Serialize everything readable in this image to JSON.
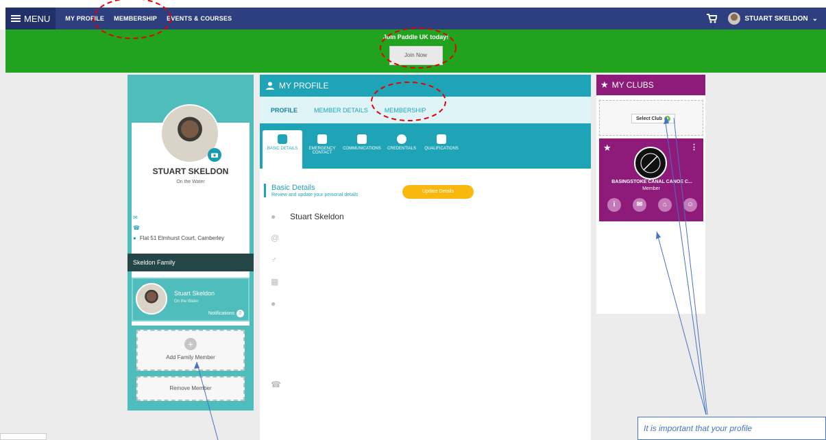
{
  "nav": {
    "menu_label": "MENU",
    "links": [
      "MY PROFILE",
      "MEMBERSHIP",
      "EVENTS & COURSES"
    ],
    "user_name": "STUART SKELDON",
    "user_caret": "⌄"
  },
  "banner": {
    "title": "Join Paddle UK today!",
    "button": "Join Now"
  },
  "profile": {
    "name": "STUART SKELDON",
    "status": "On the Water",
    "address": "Flat 51 Elmhurst Court, Camberley",
    "family_title": "Skeldon Family",
    "family_member": {
      "name": "Stuart Skeldon",
      "status": "On the Water",
      "notifications_label": "Notifications",
      "notifications_count": "0"
    },
    "add_member": "Add Family Member",
    "remove_member": "Remove Member"
  },
  "center": {
    "title": "MY PROFILE",
    "tabs": [
      "PROFILE",
      "MEMBER DETAILS",
      "MEMBERSHIP"
    ],
    "subtabs": [
      "BASIC DETAILS",
      "EMERGENCY CONTACT",
      "COMMUNICATIONS",
      "CREDENTIALS",
      "QUALIFICATIONS"
    ],
    "section_title": "Basic Details",
    "section_subtitle": "Review and update your personal details",
    "update_button": "Update Details",
    "full_name": "Stuart Skeldon"
  },
  "clubs": {
    "title": "MY CLUBS",
    "select_button": "Select Club",
    "club_name": "BASINGSTOKE CANAL CANOE C...",
    "club_role": "Member"
  },
  "annotation": {
    "note": "It is important that your profile"
  },
  "colors": {
    "nav": "#2e3f7f",
    "banner": "#22a320",
    "teal": "#4fbdbb",
    "accent": "#1fa4b7",
    "club": "#8e1a79",
    "button_yellow": "#f8b80e",
    "annotation": "#4472c4",
    "dashed_marker": "#e60000"
  }
}
